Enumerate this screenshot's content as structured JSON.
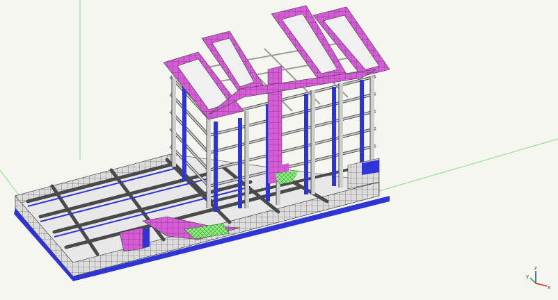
{
  "viewport": {
    "background": "#f6f6f0",
    "guide_line_color": "#7fe07f"
  },
  "model": {
    "mesh_fill": "#dcdcdc",
    "mesh_line": "#3a3a3a",
    "beam_color": "#4a4a4a",
    "column_color": "#2f34d6",
    "slab_edge_color": "#2f34d6",
    "roof_color": "#d65bd6",
    "core_color": "#c85ac8",
    "stair_color": "#8af07a",
    "floors": 7
  },
  "axis_triad": {
    "x_label": "x",
    "y_label": "y",
    "z_label": "z",
    "x_color": "#d02020",
    "y_color": "#20a020",
    "z_color": "#2040d0"
  }
}
